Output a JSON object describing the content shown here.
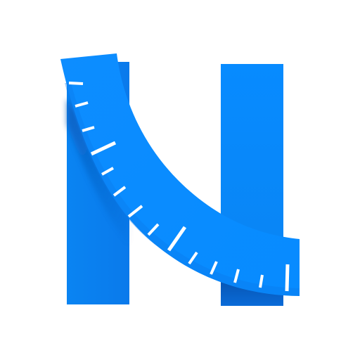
{
  "logo": {
    "icon": "measuring-tape-n-logo-icon",
    "colors": {
      "background": "#ffffff",
      "primary_blue": "#0A8BFF",
      "dark_blue": "#0B66D8",
      "shadow_blue": "#0756B8",
      "tick_white": "#ffffff"
    },
    "tick_count": 17
  }
}
